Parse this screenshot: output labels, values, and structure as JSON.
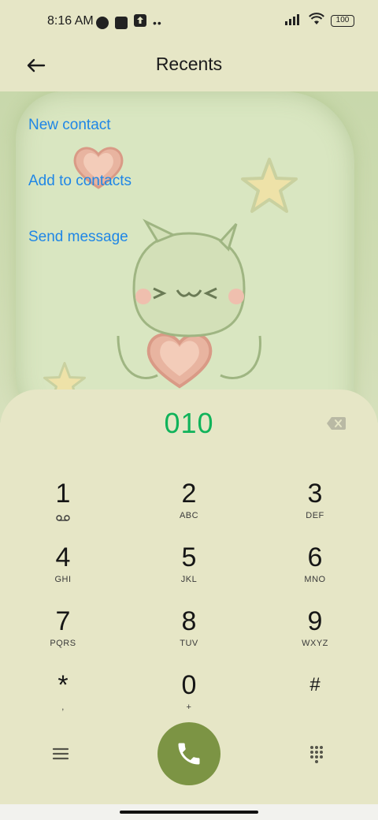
{
  "status_bar": {
    "time": "8:16 AM",
    "battery": "100"
  },
  "header": {
    "title": "Recents",
    "back_icon": "arrow-left-icon"
  },
  "actions": {
    "new_contact": "New contact",
    "add_to_contacts": "Add to contacts",
    "send_message": "Send message"
  },
  "dialer": {
    "number": "010",
    "keys": [
      {
        "digit": "1",
        "letters": ""
      },
      {
        "digit": "2",
        "letters": "ABC"
      },
      {
        "digit": "3",
        "letters": "DEF"
      },
      {
        "digit": "4",
        "letters": "GHI"
      },
      {
        "digit": "5",
        "letters": "JKL"
      },
      {
        "digit": "6",
        "letters": "MNO"
      },
      {
        "digit": "7",
        "letters": "PQRS"
      },
      {
        "digit": "8",
        "letters": "TUV"
      },
      {
        "digit": "9",
        "letters": "WXYZ"
      },
      {
        "digit": "*",
        "letters": ","
      },
      {
        "digit": "0",
        "letters": "+"
      },
      {
        "digit": "#",
        "letters": ""
      }
    ]
  },
  "colors": {
    "background": "#e6e6c6",
    "link": "#1f86e6",
    "number": "#10b35a",
    "call_button": "#7c9444"
  }
}
